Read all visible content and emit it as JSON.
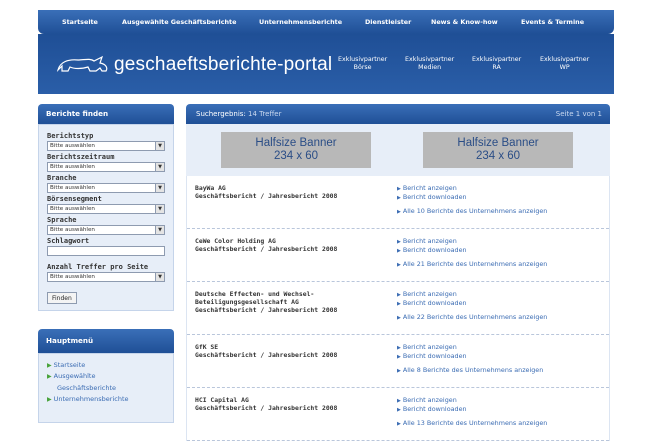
{
  "topnav": {
    "items": [
      "Startseite",
      "Ausgewählte Geschäftsberichte",
      "Unternehmensberichte",
      "Dienstleister",
      "News & Know-how",
      "Events & Termine"
    ]
  },
  "header": {
    "logo_text": "geschaeftsberichte-portal",
    "partners": [
      {
        "line1": "Exklusivpartner",
        "line2": "Börse"
      },
      {
        "line1": "Exklusivpartner",
        "line2": "Medien"
      },
      {
        "line1": "Exklusivpartner",
        "line2": "RA"
      },
      {
        "line1": "Exklusivpartner",
        "line2": "WP"
      }
    ]
  },
  "sidebar": {
    "title": "Berichte finden",
    "filters": [
      {
        "label": "Berichtstyp",
        "value": "Bitte auswählen"
      },
      {
        "label": "Berichtszeitraum",
        "value": "Bitte auswählen"
      },
      {
        "label": "Branche",
        "value": "Bitte auswählen"
      },
      {
        "label": "Börsensegment",
        "value": "Bitte auswählen"
      },
      {
        "label": "Sprache",
        "value": "Bitte auswählen"
      }
    ],
    "keyword_label": "Schlagwort",
    "per_page_label": "Anzahl Treffer pro Seite",
    "per_page_value": "Bitte auswählen",
    "button": "Finden",
    "menu_title": "Hauptmenü",
    "menu": {
      "item1": "Startseite",
      "item2": "Ausgewählte",
      "item2_sub": "Geschäftsberichte",
      "item3": "Unternehmensberichte"
    }
  },
  "results": {
    "header_label": "Suchergebnis:",
    "header_count": "14 Treffer",
    "page_info": "Seite 1 von 1",
    "banners": [
      {
        "line1": "Halfsize Banner",
        "line2": "234 x 60"
      },
      {
        "line1": "Halfsize Banner",
        "line2": "234 x 60"
      }
    ],
    "view_label": "Bericht anzeigen",
    "download_label": "Bericht downloaden",
    "rows": [
      {
        "company": "BayWa AG",
        "report": "Geschäftsbericht / Jahresbericht 2008",
        "all": "Alle 10 Berichte des Unternehmens anzeigen"
      },
      {
        "company": "CeWe Color Holding AG",
        "report": "Geschäftsbericht / Jahresbericht 2008",
        "all": "Alle 21 Berichte des Unternehmens anzeigen"
      },
      {
        "company": "Deutsche Effecten- und Wechsel-",
        "company2": "Beteiligungsgesellschaft AG",
        "report": "Geschäftsbericht / Jahresbericht 2008",
        "all": "Alle 22 Berichte des Unternehmens anzeigen"
      },
      {
        "company": "GfK SE",
        "report": "Geschäftsbericht / Jahresbericht 2008",
        "all": "Alle 8 Berichte des Unternehmens anzeigen"
      },
      {
        "company": "HCI Capital AG",
        "report": "Geschäftsbericht / Jahresbericht 2008",
        "all": "Alle 13 Berichte des Unternehmens anzeigen"
      }
    ]
  }
}
